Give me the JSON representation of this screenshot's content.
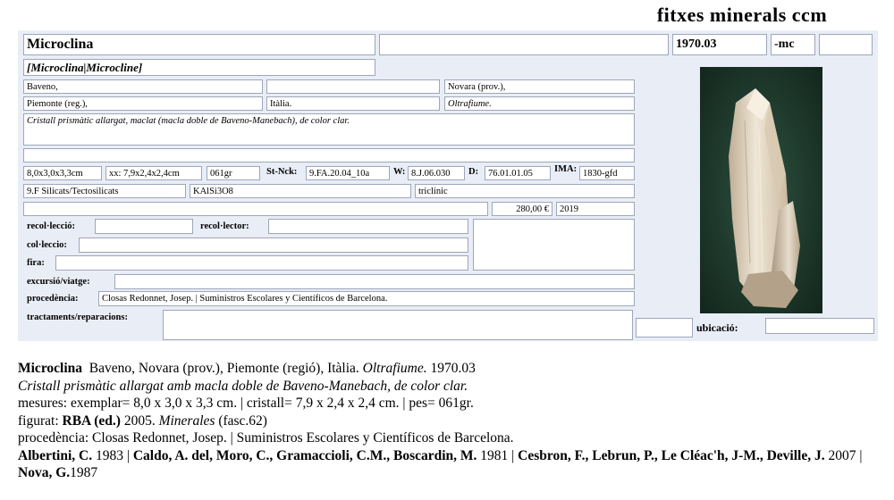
{
  "header": {
    "title": "fitxes minerals ccm"
  },
  "card": {
    "name": "Microclina",
    "catalog_number": "1970.03",
    "suffix": "-mc",
    "synonyms": "[Microclina|Microcline]",
    "locality": "Baveno,",
    "region": "Novara (prov.),",
    "province": "Piemonte (reg.),",
    "country": "Itàlia.",
    "source": "Oltrafiume.",
    "description": "Cristall prismàtic allargat, maclat (macla doble de Baveno-Manebach), de color clar.",
    "size_specimen": "8,0x3,0x3,3cm",
    "size_crystal": "xx: 7,9x2,4x2,4cm",
    "weight": "061gr",
    "labels": {
      "strunz": "St-Nck:",
      "w": "W:",
      "d": "D:",
      "ima": "IMA:",
      "collection_place": "recol·lecció:",
      "collector": "recol·lector:",
      "collection": "col·leccio:",
      "fair": "fira:",
      "trip": "excursió/viatge:",
      "provenance": "procedència:",
      "treatments": "tractaments/reparacions:",
      "location": "ubicació:"
    },
    "strunz": "9.FA.20.04_10a",
    "w": "8.J.06.030",
    "d": "76.01.01.05",
    "ima": "1830-gfd",
    "class": "9.F Silicats/Tectosilicats",
    "formula": "KAlSi3O8",
    "system": "triclínic",
    "price": "280,00 €",
    "year": "2019",
    "provenance": "Closas Redonnet, Josep. | Suministros Escolares y Científicos de Barcelona."
  },
  "summary": {
    "line1_name": "Microclina",
    "line1_rest": "Baveno, Novara (prov.), Piemonte (regió), Itàlia.",
    "line1_source": "Oltrafiume.",
    "line1_number": "1970.03",
    "line2": "Cristall prismàtic allargat amb macla doble de Baveno-Manebach, de color clar.",
    "line3": "mesures: exemplar= 8,0 x 3,0 x 3,3 cm. | cristall= 7,9 x 2,4 x 2,4 cm. | pes= 061gr.",
    "line4_prefix": "figurat:",
    "line4_pub": "RBA (ed.)",
    "line4_year": "2005.",
    "line4_title": "Minerales",
    "line4_fasc": "(fasc.62)",
    "line5": "procedència: Closas Redonnet, Josep. | Suministros Escolares y Científicos de Barcelona.",
    "refs": [
      {
        "authors": "Albertini, C.",
        "year": "1983"
      },
      {
        "authors": "Caldo, A. del, Moro, C., Gramaccioli, C.M., Boscardin, M.",
        "year": "1981"
      },
      {
        "authors": "Cesbron, F., Lebrun, P., Le Cléac'h, J-M., Deville, J.",
        "year": "2007"
      },
      {
        "authors": "Nova, G.",
        "year": "1987"
      }
    ]
  }
}
